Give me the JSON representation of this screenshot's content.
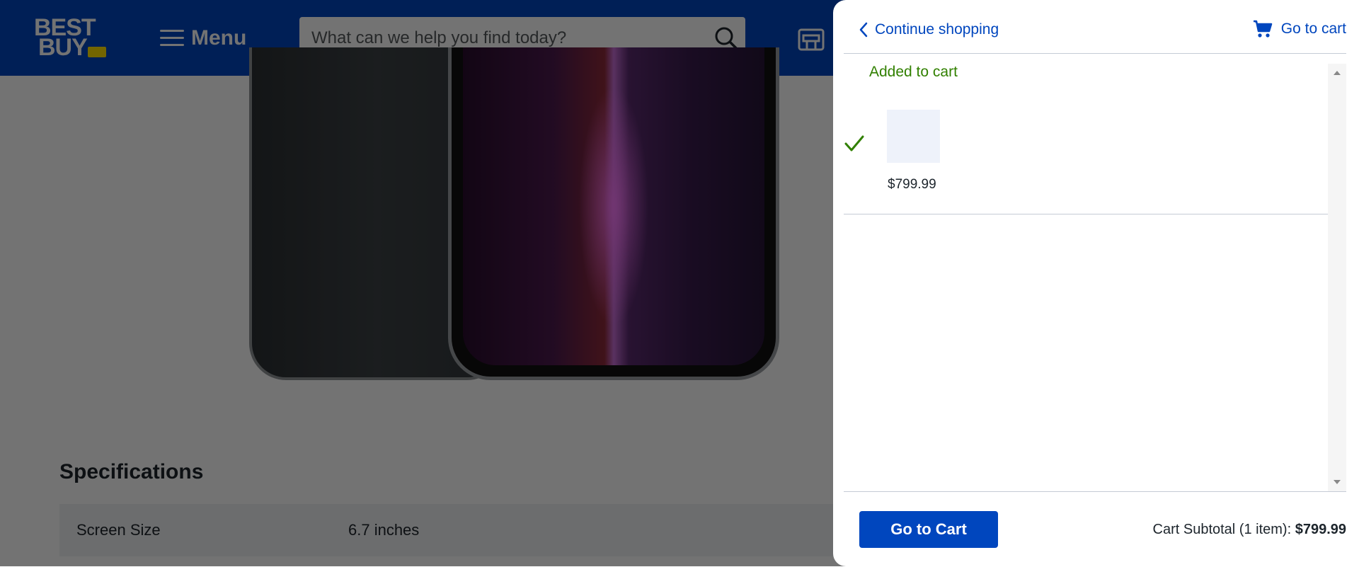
{
  "header": {
    "logo_line1": "BEST",
    "logo_line2": "BUY",
    "menu_label": "Menu",
    "search_placeholder": "What can we help you find today?",
    "brand_color": "#0046be",
    "tag_color": "#ffe000"
  },
  "specs": {
    "title": "Specifications",
    "rows": [
      {
        "label": "Screen Size",
        "value": "6.7 inches"
      }
    ]
  },
  "cart_drawer": {
    "continue_label": "Continue shopping",
    "goto_cart_link": "Go to cart",
    "added_label": "Added to cart",
    "item": {
      "price": "$799.99"
    },
    "footer": {
      "button_label": "Go to Cart",
      "subtotal_label": "Cart Subtotal (1 item):",
      "subtotal_value": "$799.99"
    },
    "icons": [
      "chevron-left-icon",
      "cart-icon",
      "check-icon"
    ]
  }
}
